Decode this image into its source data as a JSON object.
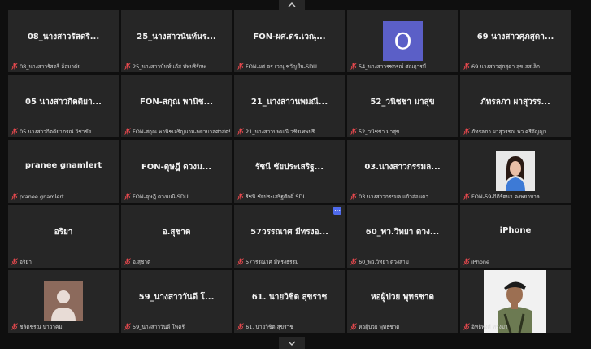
{
  "tiles": [
    {
      "name": "08_นางสาวรัสดรี...",
      "label": "08_นางสาวรัสดรี อ้อมาตัย"
    },
    {
      "name": "25_นางสาวนันท์นร...",
      "label": "25_นางสาวนันท์นภัส ทัพบริรักษ"
    },
    {
      "name": "FON-ผศ.ดร.เวณุ...",
      "label": "FON-ผศ.ดร.เวณุ ชวัญยืน-SDU"
    },
    {
      "name": "",
      "label": "54_นางสาวรชกรณ์ ศณฤารมี",
      "avatar_letter": "O"
    },
    {
      "name": "69 นางสาวศุภสุดา...",
      "label": "69 นางสาวศุภสุดา สุขเลสเล็ก"
    },
    {
      "name": "05 นางสาวกิตติยา...",
      "label": "05 นางสาวกิตติยาภรณ์ วิชาขัย"
    },
    {
      "name": "FON-สกุณ พานิช...",
      "label": "FON-สกุณ พานิชเจริญนาม-พยาบาลศาสตร์"
    },
    {
      "name": "21_นางสาวนพมณี...",
      "label": "21_นางสาวนพมณี วชิรเทพปรี"
    },
    {
      "name": "52_วนิชชา มาสุข",
      "label": "52_วนิชชา มาสุข"
    },
    {
      "name": "ภัทรลภา ผาสุวรร...",
      "label": "ภัทรลภา ผาสุวรรณ พว.ศรีอัญญา"
    },
    {
      "name": "pranee gnamlert",
      "label": "pranee gnamlert"
    },
    {
      "name": "FON-ดุษฎี ดวงม...",
      "label": "FON-ดุษฎี ดวงมณี-SDU"
    },
    {
      "name": "รัชนี ชัยประเสริฐ...",
      "label": "รัชนี ชัยประเสริฐศักดิ์ SDU"
    },
    {
      "name": "03.นางสาวกรรมล...",
      "label": "03.นางสาวกรรมล แก้วอ่อนตา"
    },
    {
      "name": "",
      "label": "FON-59-กิติรัตนา คงพยาบาล",
      "photo": "woman"
    },
    {
      "name": "อริยา",
      "label": "อริยา"
    },
    {
      "name": "อ.สุชาต",
      "label": "อ.สุชาต"
    },
    {
      "name": "57วรรณาศ มีทรงอ...",
      "label": "57วรรณาศ มีทรงธรรม",
      "more_icon": "more-options-icon"
    },
    {
      "name": "60_พว.วิทยา ดวง...",
      "label": "60_พว.วิทยา ดวงสาม"
    },
    {
      "name": "iPhone",
      "label": "iPhone"
    },
    {
      "name": "",
      "label": "ชลิดชรณ นาวาคม",
      "photo": "placeholder"
    },
    {
      "name": "59_นางสาววันดี โ...",
      "label": "59_นางสาววันดี โพครี"
    },
    {
      "name": "61. นายวิชิต สุขราช",
      "label": "61. นายวิชิต สุขราช"
    },
    {
      "name": "หอผู้ป่วย พุทธชาด",
      "label": "หอผู้ป่วย พุทธชาด"
    },
    {
      "name": "",
      "label": "อิทธิพงศ์ ทรงมา",
      "photo": "soldier"
    }
  ],
  "scroll_up_icon": "chevron-up-icon",
  "scroll_down_icon": "chevron-down-icon",
  "colors": {
    "tile": "#262626",
    "background": "#0f0f0f",
    "avatar": "#5b5fc7",
    "mic_off": "#e5484d"
  }
}
